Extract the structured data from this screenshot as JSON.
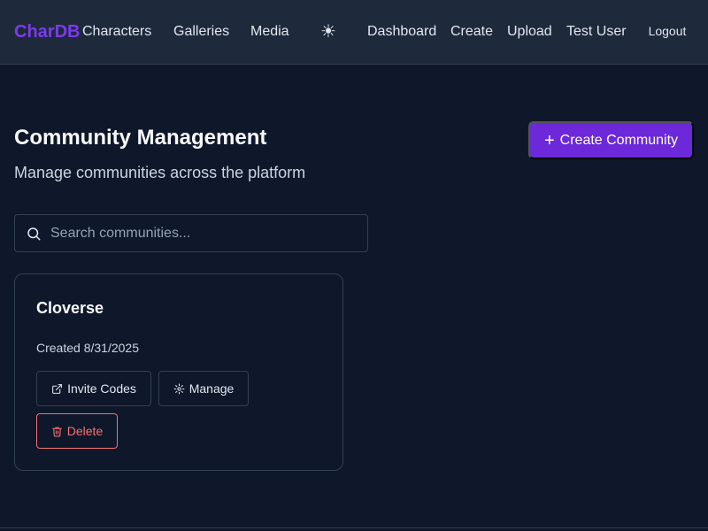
{
  "nav": {
    "brand": "CharDB",
    "links": [
      "Characters",
      "Galleries",
      "Media"
    ],
    "theme_toggle": "☀",
    "right_links": [
      "Dashboard",
      "Create",
      "Upload"
    ],
    "user_name": "Test User",
    "logout": "Logout"
  },
  "page": {
    "title": "Community Management",
    "subtitle": "Manage communities across the platform",
    "create_button": "Create Community",
    "create_button_icon": "+"
  },
  "search": {
    "placeholder": "Search communities...",
    "value": ""
  },
  "communities": [
    {
      "name": "Cloverse",
      "created": "Created 8/31/2025",
      "actions": {
        "invite_codes": "Invite Codes",
        "manage": "Manage",
        "delete": "Delete"
      }
    }
  ],
  "icons": {
    "search": "search-icon",
    "invite": "external-link-icon",
    "manage": "gear-icon",
    "delete": "trash-icon",
    "theme": "sun-icon"
  },
  "colors": {
    "background": "#0f172a",
    "navbar": "#1e293b",
    "brand": "#7c3aed",
    "accent_button": "#6d28d9",
    "danger": "#f87171",
    "border": "#334155"
  }
}
